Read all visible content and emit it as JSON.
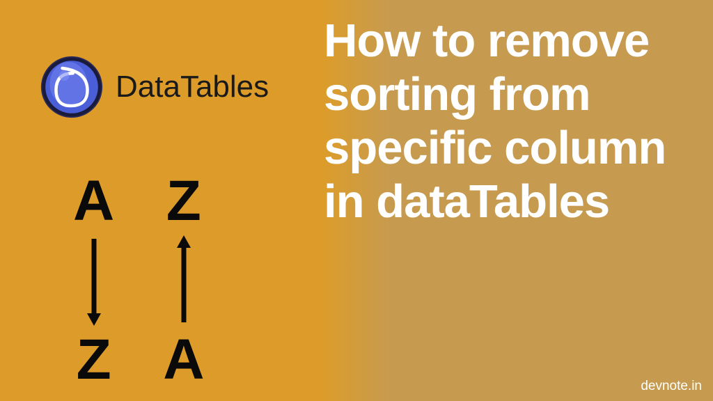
{
  "logo": {
    "text": "DataTables"
  },
  "sort": {
    "col1_top": "A",
    "col1_bottom": "Z",
    "col2_top": "Z",
    "col2_bottom": "A"
  },
  "heading": "How to remove sorting from specific column in dataTables",
  "footer": "devnote.in"
}
